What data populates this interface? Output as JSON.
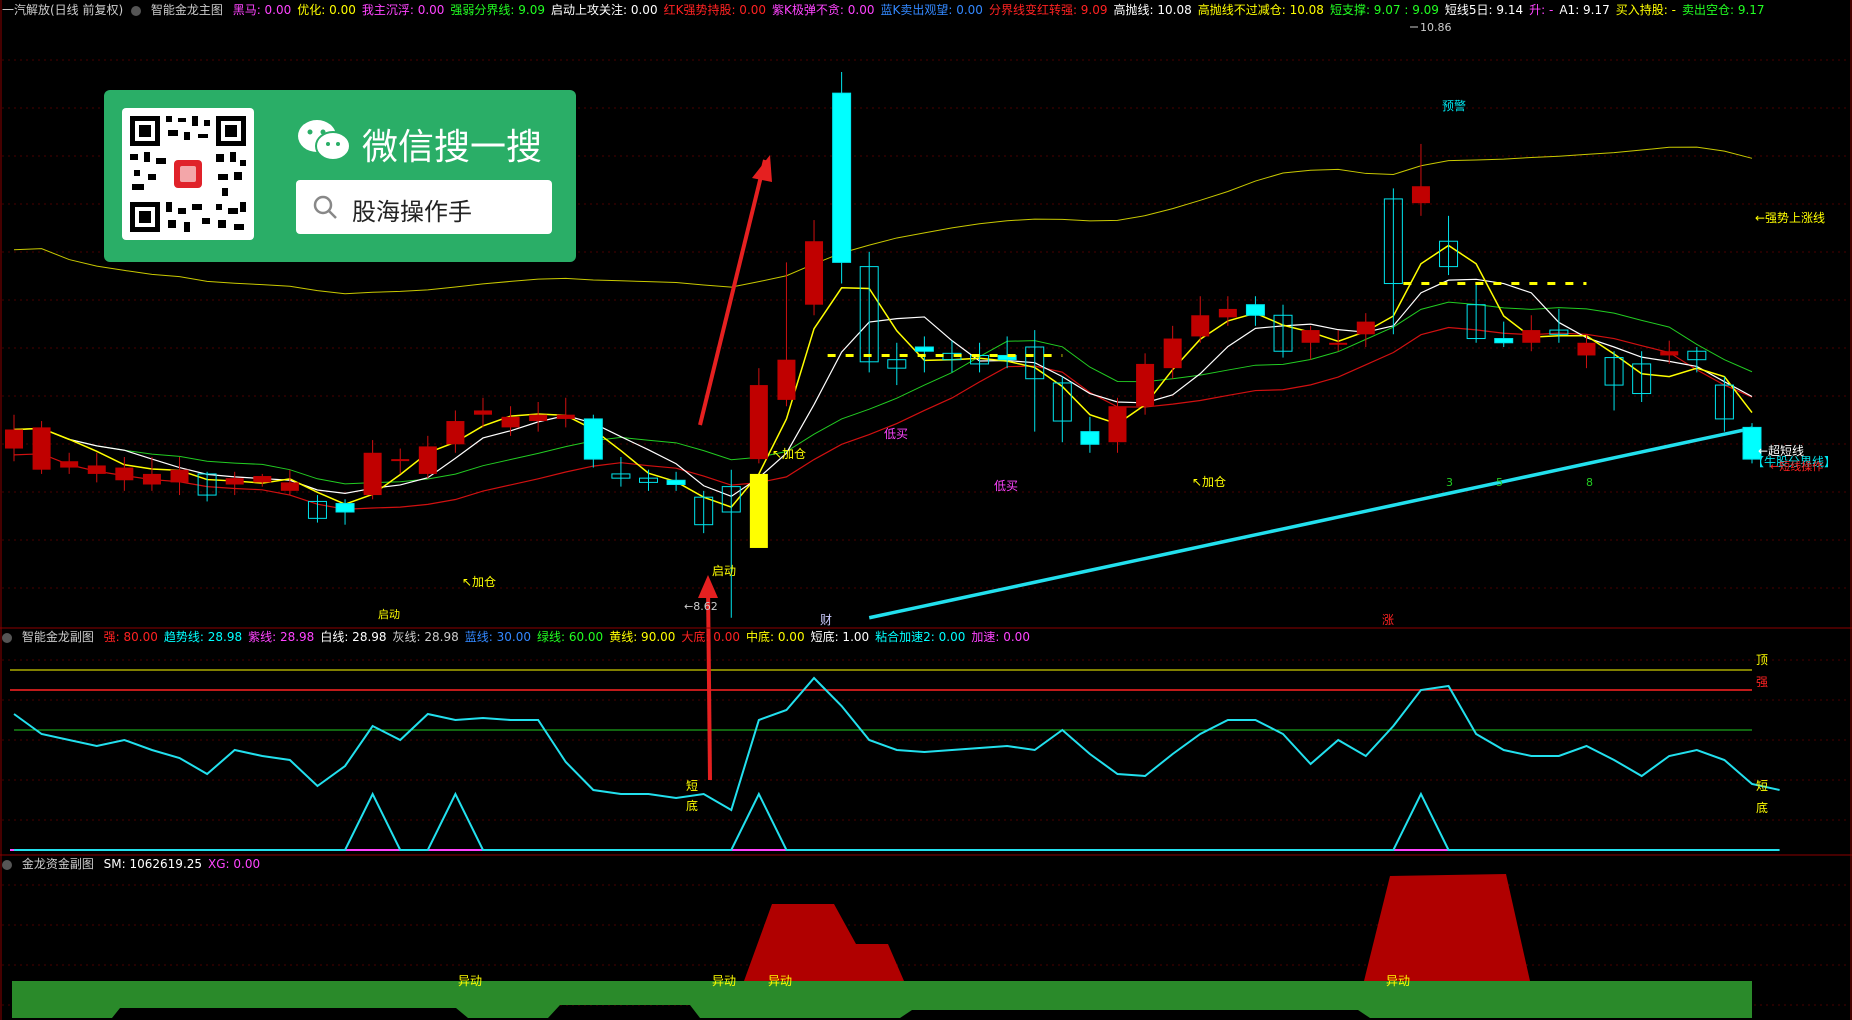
{
  "window": {
    "title": "一汽解放(日线 前复权)"
  },
  "main_panel": {
    "name": "智能金龙主图",
    "indicators": [
      {
        "label": "黑马",
        "value": "0.00",
        "color": "#ff44ff"
      },
      {
        "label": "优化",
        "value": "0.00",
        "color": "#ffff00"
      },
      {
        "label": "我主沉浮",
        "value": "0.00",
        "color": "#ff44ff"
      },
      {
        "label": "强弱分界线",
        "value": "9.09",
        "color": "#22ff22"
      },
      {
        "label": "启动上攻关注",
        "value": "0.00",
        "color": "#ffffff"
      },
      {
        "label": "红K强势持股",
        "value": "0.00",
        "color": "#ff2222"
      },
      {
        "label": "紫K极弹不贪",
        "value": "0.00",
        "color": "#ff44ff"
      },
      {
        "label": "蓝K卖出观望",
        "value": "0.00",
        "color": "#3388ff"
      },
      {
        "label": "分界线变红转强",
        "value": "9.09",
        "color": "#ff2222"
      },
      {
        "label": "高抛线",
        "value": "10.08",
        "color": "#ffffff"
      },
      {
        "label": "高抛线不过减仓",
        "value": "10.08",
        "color": "#ffff00"
      },
      {
        "label": "短支撑",
        "value": "9.07 : 9.09",
        "color": "#22ff22"
      },
      {
        "label": "短线5日",
        "value": "9.14",
        "color": "#ffffff"
      },
      {
        "label": "升",
        "value": "-",
        "color": "#ff44ff"
      },
      {
        "label": "A1",
        "value": "9.17",
        "color": "#ffffff"
      },
      {
        "label": "买入持股",
        "value": "-",
        "color": "#ffff00"
      },
      {
        "label": "卖出空仓",
        "value": "9.17",
        "color": "#22ff22"
      }
    ],
    "annotations": {
      "high_price": "10.86",
      "low_price": "8.62",
      "warning": "预警",
      "strong_up": "←强势上涨线",
      "super_short": "←超短线",
      "short_support": "【牛股分界线】",
      "short_support2": "←短线操作",
      "add_position_1": "↖加仓",
      "add_position_2": "↖加仓",
      "add_position_3": "↖加仓",
      "start_1": "启动",
      "start_2": "启动",
      "low_buy_1": "低买",
      "low_buy_2": "低买",
      "cai": "财",
      "zhang": "涨",
      "num_3": "3",
      "num_5": "5",
      "num_8": "8"
    }
  },
  "sub_panel_1": {
    "name": "智能金龙副图",
    "indicators": [
      {
        "label": "强",
        "value": "80.00",
        "color": "#ff2222"
      },
      {
        "label": "趋势线",
        "value": "28.98",
        "color": "#00ffff"
      },
      {
        "label": "紫线",
        "value": "28.98",
        "color": "#ff44ff"
      },
      {
        "label": "白线",
        "value": "28.98",
        "color": "#ffffff"
      },
      {
        "label": "灰线",
        "value": "28.98",
        "color": "#cccccc"
      },
      {
        "label": "蓝线",
        "value": "30.00",
        "color": "#3388ff"
      },
      {
        "label": "绿线",
        "value": "60.00",
        "color": "#22ff22"
      },
      {
        "label": "黄线",
        "value": "90.00",
        "color": "#ffff00"
      },
      {
        "label": "大底",
        "value": "0.00",
        "color": "#ff2222"
      },
      {
        "label": "中底",
        "value": "0.00",
        "color": "#ffff00"
      },
      {
        "label": "短底",
        "value": "1.00",
        "color": "#ffffff"
      },
      {
        "label": "粘合加速2",
        "value": "0.00",
        "color": "#00ffff"
      },
      {
        "label": "加速",
        "value": "0.00",
        "color": "#ff44ff"
      }
    ],
    "labels": {
      "top": "顶",
      "strong": "强",
      "short_1": "短",
      "bottom_1": "底",
      "short_2": "短",
      "bottom_2": "底"
    }
  },
  "sub_panel_2": {
    "name": "金龙资金副图",
    "indicators": [
      {
        "label": "SM",
        "value": "1062619.25",
        "color": "#ffffff"
      },
      {
        "label": "XG",
        "value": "0.00",
        "color": "#ff44ff"
      }
    ],
    "labels": {
      "yidong_1": "异动",
      "yidong_2": "异动",
      "yidong_3": "异动",
      "yidong_4": "异动"
    }
  },
  "wechat_card": {
    "title": "微信搜一搜",
    "search_text": "股海操作手"
  },
  "colors": {
    "up": "#c00000",
    "down": "#00ffff",
    "yellow": "#ffff00",
    "grid": "#5a0000",
    "panel_border": "#8b0000"
  },
  "chart_data": {
    "type": "candlestick",
    "candles": [
      {
        "o": 9.42,
        "c": 9.51,
        "h": 9.58,
        "l": 9.36
      },
      {
        "o": 9.32,
        "c": 9.52,
        "h": 9.55,
        "l": 9.3
      },
      {
        "o": 9.33,
        "c": 9.36,
        "h": 9.4,
        "l": 9.3
      },
      {
        "o": 9.3,
        "c": 9.34,
        "h": 9.4,
        "l": 9.26
      },
      {
        "o": 9.27,
        "c": 9.33,
        "h": 9.38,
        "l": 9.22
      },
      {
        "o": 9.25,
        "c": 9.3,
        "h": 9.38,
        "l": 9.22
      },
      {
        "o": 9.26,
        "c": 9.32,
        "h": 9.38,
        "l": 9.2
      },
      {
        "o": 9.3,
        "c": 9.2,
        "h": 9.31,
        "l": 9.17
      },
      {
        "o": 9.25,
        "c": 9.28,
        "h": 9.31,
        "l": 9.2
      },
      {
        "o": 9.26,
        "c": 9.29,
        "h": 9.3,
        "l": 9.24
      },
      {
        "o": 9.22,
        "c": 9.26,
        "h": 9.32,
        "l": 9.2
      },
      {
        "o": 9.17,
        "c": 9.09,
        "h": 9.2,
        "l": 9.07
      },
      {
        "o": 9.16,
        "c": 9.12,
        "h": 9.18,
        "l": 9.06
      },
      {
        "o": 9.2,
        "c": 9.4,
        "h": 9.46,
        "l": 9.18
      },
      {
        "o": 9.37,
        "c": 9.37,
        "h": 9.42,
        "l": 9.3
      },
      {
        "o": 9.3,
        "c": 9.43,
        "h": 9.48,
        "l": 9.28
      },
      {
        "o": 9.44,
        "c": 9.55,
        "h": 9.6,
        "l": 9.4
      },
      {
        "o": 9.58,
        "c": 9.6,
        "h": 9.66,
        "l": 9.52
      },
      {
        "o": 9.52,
        "c": 9.57,
        "h": 9.62,
        "l": 9.48
      },
      {
        "o": 9.55,
        "c": 9.58,
        "h": 9.64,
        "l": 9.5
      },
      {
        "o": 9.56,
        "c": 9.58,
        "h": 9.66,
        "l": 9.52
      },
      {
        "o": 9.56,
        "c": 9.37,
        "h": 9.58,
        "l": 9.33
      },
      {
        "o": 9.3,
        "c": 9.28,
        "h": 9.38,
        "l": 9.24
      },
      {
        "o": 9.28,
        "c": 9.26,
        "h": 9.32,
        "l": 9.22
      },
      {
        "o": 9.27,
        "c": 9.25,
        "h": 9.31,
        "l": 9.22
      },
      {
        "o": 9.19,
        "c": 9.06,
        "h": 9.22,
        "l": 9.02
      },
      {
        "o": 9.24,
        "c": 9.12,
        "h": 9.32,
        "l": 8.62
      },
      {
        "o": 9.37,
        "c": 9.72,
        "h": 9.8,
        "l": 9.35
      },
      {
        "o": 9.65,
        "c": 9.84,
        "h": 10.3,
        "l": 9.62
      },
      {
        "o": 10.1,
        "c": 10.4,
        "h": 10.5,
        "l": 10.05
      },
      {
        "o": 11.1,
        "c": 10.3,
        "h": 11.2,
        "l": 10.2
      },
      {
        "o": 10.28,
        "c": 9.83,
        "h": 10.35,
        "l": 9.78
      },
      {
        "o": 9.84,
        "c": 9.8,
        "h": 9.92,
        "l": 9.72
      },
      {
        "o": 9.9,
        "c": 9.88,
        "h": 9.95,
        "l": 9.78
      },
      {
        "o": 9.87,
        "c": 9.84,
        "h": 9.93,
        "l": 9.78
      },
      {
        "o": 9.86,
        "c": 9.82,
        "h": 9.92,
        "l": 9.78
      },
      {
        "o": 9.86,
        "c": 9.84,
        "h": 9.95,
        "l": 9.8
      },
      {
        "o": 9.9,
        "c": 9.75,
        "h": 9.98,
        "l": 9.5
      },
      {
        "o": 9.73,
        "c": 9.55,
        "h": 9.76,
        "l": 9.45
      },
      {
        "o": 9.5,
        "c": 9.44,
        "h": 9.57,
        "l": 9.4
      },
      {
        "o": 9.45,
        "c": 9.62,
        "h": 9.66,
        "l": 9.4
      },
      {
        "o": 9.62,
        "c": 9.82,
        "h": 9.87,
        "l": 9.58
      },
      {
        "o": 9.8,
        "c": 9.94,
        "h": 10.0,
        "l": 9.75
      },
      {
        "o": 9.95,
        "c": 10.05,
        "h": 10.14,
        "l": 9.92
      },
      {
        "o": 10.04,
        "c": 10.08,
        "h": 10.14,
        "l": 10.0
      },
      {
        "o": 10.1,
        "c": 10.05,
        "h": 10.14,
        "l": 10.0
      },
      {
        "o": 10.05,
        "c": 9.88,
        "h": 10.1,
        "l": 9.85
      },
      {
        "o": 9.92,
        "c": 9.98,
        "h": 10.0,
        "l": 9.84
      },
      {
        "o": 9.92,
        "c": 9.92,
        "h": 9.98,
        "l": 9.88
      },
      {
        "o": 9.96,
        "c": 10.02,
        "h": 10.06,
        "l": 9.9
      },
      {
        "o": 10.6,
        "c": 10.2,
        "h": 10.65,
        "l": 9.96
      },
      {
        "o": 10.58,
        "c": 10.66,
        "h": 10.86,
        "l": 10.52
      },
      {
        "o": 10.4,
        "c": 10.28,
        "h": 10.52,
        "l": 10.24
      },
      {
        "o": 10.1,
        "c": 9.94,
        "h": 10.2,
        "l": 9.92
      },
      {
        "o": 9.94,
        "c": 9.92,
        "h": 10.02,
        "l": 9.9
      },
      {
        "o": 9.92,
        "c": 9.98,
        "h": 10.05,
        "l": 9.88
      },
      {
        "o": 9.98,
        "c": 9.96,
        "h": 10.08,
        "l": 9.92
      },
      {
        "o": 9.86,
        "c": 9.92,
        "h": 9.96,
        "l": 9.8
      },
      {
        "o": 9.85,
        "c": 9.72,
        "h": 9.88,
        "l": 9.6
      },
      {
        "o": 9.82,
        "c": 9.68,
        "h": 9.88,
        "l": 9.64
      },
      {
        "o": 9.86,
        "c": 9.88,
        "h": 9.93,
        "l": 9.82
      },
      {
        "o": 9.88,
        "c": 9.84,
        "h": 9.9,
        "l": 9.78
      },
      {
        "o": 9.72,
        "c": 9.56,
        "h": 9.76,
        "l": 9.5
      },
      {
        "o": 9.52,
        "c": 9.37,
        "h": 9.54,
        "l": 9.35
      }
    ]
  }
}
